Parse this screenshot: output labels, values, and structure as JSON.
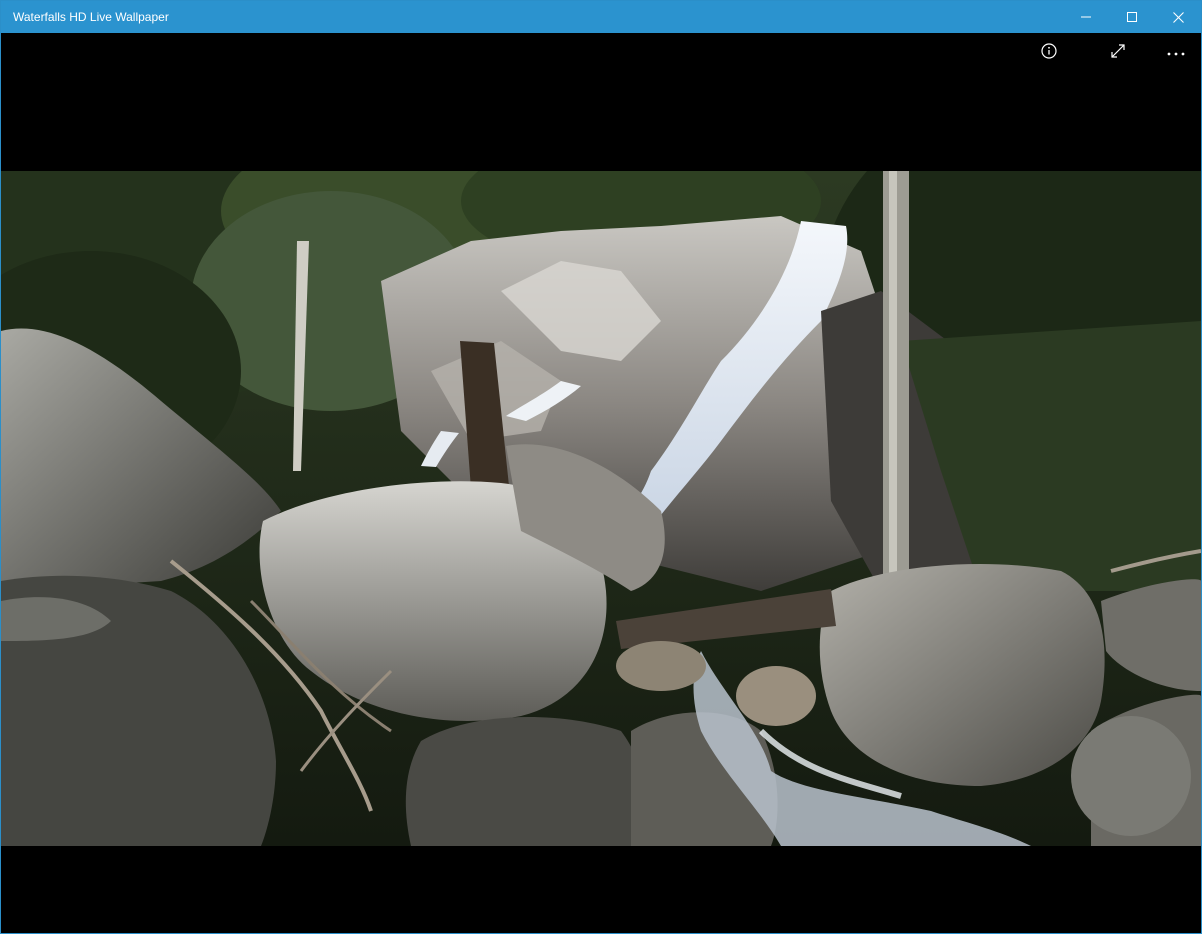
{
  "window": {
    "title": "Waterfalls HD Live Wallpaper",
    "accent_color": "#2b93cf",
    "controls": {
      "minimize_icon": "minimize-icon",
      "maximize_icon": "maximize-icon",
      "close_icon": "close-icon"
    }
  },
  "app_bar": {
    "info_icon": "info-icon",
    "fullscreen_icon": "fullscreen-icon",
    "more_icon": "more-options-icon"
  },
  "video": {
    "subject": "waterfall-scene",
    "background_color": "#000000"
  }
}
